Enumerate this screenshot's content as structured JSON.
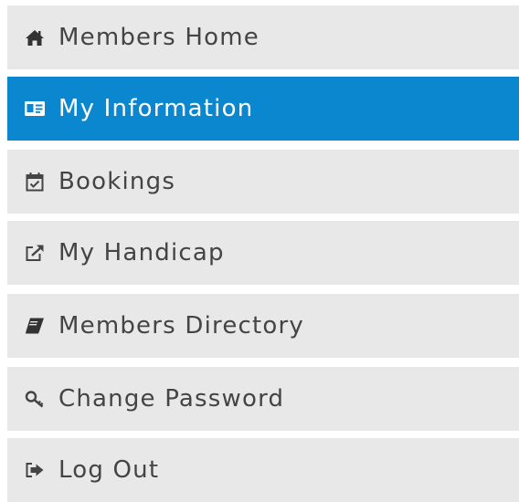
{
  "menu": {
    "items": [
      {
        "label": "Members Home",
        "icon": "home-icon",
        "active": false
      },
      {
        "label": "My Information",
        "icon": "id-card-icon",
        "active": true
      },
      {
        "label": "Bookings",
        "icon": "calendar-check-icon",
        "active": false
      },
      {
        "label": "My Handicap",
        "icon": "external-link-icon",
        "active": false
      },
      {
        "label": "Members Directory",
        "icon": "book-icon",
        "active": false
      },
      {
        "label": "Change Password",
        "icon": "key-icon",
        "active": false
      },
      {
        "label": "Log Out",
        "icon": "sign-out-icon",
        "active": false
      }
    ],
    "colors": {
      "item_background": "#e8e8e8",
      "active_background": "#0b87cf",
      "text": "#444444",
      "active_text": "#ffffff"
    }
  }
}
